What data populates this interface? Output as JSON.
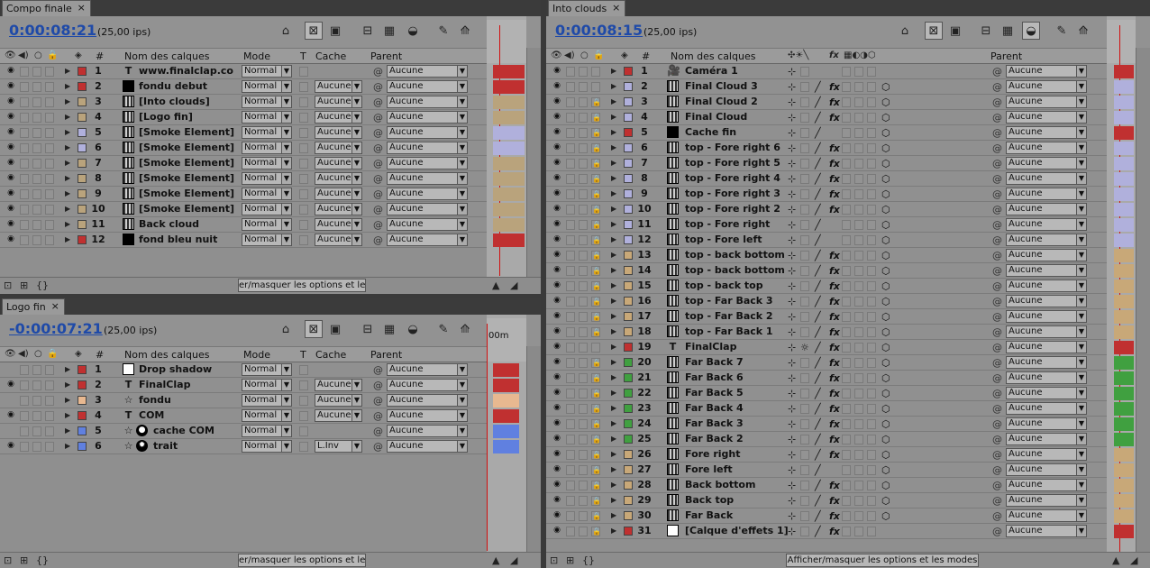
{
  "panels": {
    "compo": {
      "tab": "Compo finale",
      "timecode": "0:00:08:21",
      "fps": "(25,00 ips)",
      "col_headers": [
        "#",
        "Nom des calques",
        "Mode",
        "T",
        "Cache",
        "Parent"
      ],
      "footer_btn": "er/masquer les options et les m",
      "rows": [
        {
          "num": "1",
          "name": "www.finalclap.co",
          "type": "T",
          "label_color": "#c03030",
          "mode": "Normal",
          "cache": "",
          "parent": "Aucune",
          "eye": true
        },
        {
          "num": "2",
          "name": "fondu debut",
          "type": "solid-black",
          "label_color": "#c03030",
          "mode": "Normal",
          "cache": "Aucune",
          "parent": "Aucune",
          "eye": true
        },
        {
          "num": "3",
          "name": "[Into clouds]",
          "type": "comp",
          "label_color": "#b9a37c",
          "mode": "Normal",
          "cache": "Aucune",
          "parent": "Aucune",
          "eye": true
        },
        {
          "num": "4",
          "name": "[Logo fin]",
          "type": "comp",
          "label_color": "#b9a37c",
          "mode": "Normal",
          "cache": "Aucune",
          "parent": "Aucune",
          "eye": true
        },
        {
          "num": "5",
          "name": "[Smoke Element]",
          "type": "comp",
          "label_color": "#b0b0dc",
          "mode": "Normal",
          "cache": "Aucune",
          "parent": "Aucune",
          "eye": true
        },
        {
          "num": "6",
          "name": "[Smoke Element]",
          "type": "comp",
          "label_color": "#b0b0dc",
          "mode": "Normal",
          "cache": "Aucune",
          "parent": "Aucune",
          "eye": true
        },
        {
          "num": "7",
          "name": "[Smoke Element]",
          "type": "comp",
          "label_color": "#b9a37c",
          "mode": "Normal",
          "cache": "Aucune",
          "parent": "Aucune",
          "eye": true
        },
        {
          "num": "8",
          "name": "[Smoke Element]",
          "type": "comp",
          "label_color": "#b9a37c",
          "mode": "Normal",
          "cache": "Aucune",
          "parent": "Aucune",
          "eye": true
        },
        {
          "num": "9",
          "name": "[Smoke Element]",
          "type": "comp",
          "label_color": "#b9a37c",
          "mode": "Normal",
          "cache": "Aucune",
          "parent": "Aucune",
          "eye": true
        },
        {
          "num": "10",
          "name": "[Smoke Element]",
          "type": "comp",
          "label_color": "#b9a37c",
          "mode": "Normal",
          "cache": "Aucune",
          "parent": "Aucune",
          "eye": true
        },
        {
          "num": "11",
          "name": "Back cloud",
          "type": "comp",
          "label_color": "#b9a37c",
          "mode": "Normal",
          "cache": "Aucune",
          "parent": "Aucune",
          "eye": true
        },
        {
          "num": "12",
          "name": "fond bleu nuit",
          "type": "solid-black",
          "label_color": "#c03030",
          "mode": "Normal",
          "cache": "Aucune",
          "parent": "Aucune",
          "eye": true
        }
      ]
    },
    "logo": {
      "tab": "Logo fin",
      "timecode": "-0:00:07:21",
      "fps": "(25,00 ips)",
      "col_headers": [
        "#",
        "Nom des calques",
        "Mode",
        "T",
        "Cache",
        "Parent"
      ],
      "footer_btn": "er/masquer les options et les m",
      "ruler_label": "00m",
      "rows": [
        {
          "num": "1",
          "name": "Drop shadow",
          "type": "solid-white",
          "label_color": "#c03030",
          "mode": "Normal",
          "cache": "",
          "parent": "Aucune",
          "eye": false
        },
        {
          "num": "2",
          "name": "FinalClap",
          "type": "T",
          "label_color": "#c03030",
          "mode": "Normal",
          "cache": "Aucune",
          "parent": "Aucune",
          "eye": true
        },
        {
          "num": "3",
          "name": "fondu",
          "type": "star",
          "label_color": "#e8b890",
          "mode": "Normal",
          "cache": "Aucune",
          "parent": "Aucune",
          "eye": false
        },
        {
          "num": "4",
          "name": "COM",
          "type": "T",
          "label_color": "#c03030",
          "mode": "Normal",
          "cache": "Aucune",
          "parent": "Aucune",
          "eye": true
        },
        {
          "num": "5",
          "name": "cache COM",
          "type": "star-mask",
          "label_color": "#6080e0",
          "mode": "Normal",
          "cache": "",
          "parent": "Aucune",
          "eye": false
        },
        {
          "num": "6",
          "name": "trait",
          "type": "star-gear",
          "label_color": "#6080e0",
          "mode": "Normal",
          "cache": "L.Inv",
          "parent": "Aucune",
          "eye": true
        }
      ]
    },
    "clouds": {
      "tab": "Into clouds",
      "timecode": "0:00:08:15",
      "fps": "(25,00 ips)",
      "col_headers": [
        "#",
        "Nom des calques",
        "Parent"
      ],
      "footer_btn": "Afficher/masquer les options et les modes",
      "rows": [
        {
          "num": "1",
          "name": "Caméra 1",
          "type": "cam",
          "label_color": "#c03030",
          "lock": false,
          "slash": false,
          "fx": false,
          "cube": false
        },
        {
          "num": "2",
          "name": "Final Cloud 3",
          "type": "comp",
          "label_color": "#b0b0dc",
          "lock": false,
          "slash": true,
          "fx": true,
          "cube": true
        },
        {
          "num": "3",
          "name": "Final Cloud 2",
          "type": "comp",
          "label_color": "#b0b0dc",
          "lock": true,
          "slash": true,
          "fx": true,
          "cube": true
        },
        {
          "num": "4",
          "name": "Final Cloud",
          "type": "comp",
          "label_color": "#b0b0dc",
          "lock": true,
          "slash": true,
          "fx": true,
          "cube": true
        },
        {
          "num": "5",
          "name": "Cache fin",
          "type": "solid-black",
          "label_color": "#c03030",
          "lock": true,
          "slash": true,
          "fx": false,
          "cube": true
        },
        {
          "num": "6",
          "name": "top - Fore right 6",
          "type": "comp",
          "label_color": "#b0b0dc",
          "lock": true,
          "slash": true,
          "fx": true,
          "cube": true
        },
        {
          "num": "7",
          "name": "top - Fore right 5",
          "type": "comp",
          "label_color": "#b0b0dc",
          "lock": true,
          "slash": true,
          "fx": true,
          "cube": true
        },
        {
          "num": "8",
          "name": "top - Fore right 4",
          "type": "comp",
          "label_color": "#b0b0dc",
          "lock": true,
          "slash": true,
          "fx": true,
          "cube": true
        },
        {
          "num": "9",
          "name": "top - Fore right 3",
          "type": "comp",
          "label_color": "#b0b0dc",
          "lock": true,
          "slash": true,
          "fx": true,
          "cube": true
        },
        {
          "num": "10",
          "name": "top - Fore right 2",
          "type": "comp",
          "label_color": "#b0b0dc",
          "lock": true,
          "slash": true,
          "fx": true,
          "cube": true
        },
        {
          "num": "11",
          "name": "top - Fore right",
          "type": "comp",
          "label_color": "#b0b0dc",
          "lock": true,
          "slash": true,
          "fx": false,
          "cube": true
        },
        {
          "num": "12",
          "name": "top - Fore left",
          "type": "comp",
          "label_color": "#b0b0dc",
          "lock": true,
          "slash": true,
          "fx": false,
          "cube": true
        },
        {
          "num": "13",
          "name": "top - back bottom",
          "type": "comp",
          "label_color": "#c8a878",
          "lock": true,
          "slash": true,
          "fx": true,
          "cube": true
        },
        {
          "num": "14",
          "name": "top - back bottom",
          "type": "comp",
          "label_color": "#c8a878",
          "lock": true,
          "slash": true,
          "fx": true,
          "cube": true
        },
        {
          "num": "15",
          "name": "top - back top",
          "type": "comp",
          "label_color": "#c8a878",
          "lock": true,
          "slash": true,
          "fx": true,
          "cube": true
        },
        {
          "num": "16",
          "name": "top - Far Back 3",
          "type": "comp",
          "label_color": "#c8a878",
          "lock": true,
          "slash": true,
          "fx": true,
          "cube": true
        },
        {
          "num": "17",
          "name": "top - Far Back 2",
          "type": "comp",
          "label_color": "#c8a878",
          "lock": true,
          "slash": true,
          "fx": true,
          "cube": true
        },
        {
          "num": "18",
          "name": "top - Far Back 1",
          "type": "comp",
          "label_color": "#c8a878",
          "lock": true,
          "slash": true,
          "fx": true,
          "cube": true
        },
        {
          "num": "19",
          "name": "FinalClap",
          "type": "T",
          "label_color": "#c03030",
          "lock": false,
          "slash": true,
          "fx": true,
          "cube": true
        },
        {
          "num": "20",
          "name": "Far Back 7",
          "type": "comp",
          "label_color": "#40a040",
          "lock": true,
          "slash": true,
          "fx": true,
          "cube": true
        },
        {
          "num": "21",
          "name": "Far Back 6",
          "type": "comp",
          "label_color": "#40a040",
          "lock": true,
          "slash": true,
          "fx": true,
          "cube": true
        },
        {
          "num": "22",
          "name": "Far Back 5",
          "type": "comp",
          "label_color": "#40a040",
          "lock": true,
          "slash": true,
          "fx": true,
          "cube": true
        },
        {
          "num": "23",
          "name": "Far Back 4",
          "type": "comp",
          "label_color": "#40a040",
          "lock": true,
          "slash": true,
          "fx": true,
          "cube": true
        },
        {
          "num": "24",
          "name": "Far Back 3",
          "type": "comp",
          "label_color": "#40a040",
          "lock": true,
          "slash": true,
          "fx": true,
          "cube": true
        },
        {
          "num": "25",
          "name": "Far Back 2",
          "type": "comp",
          "label_color": "#40a040",
          "lock": true,
          "slash": true,
          "fx": true,
          "cube": true
        },
        {
          "num": "26",
          "name": "Fore right",
          "type": "comp",
          "label_color": "#c8a878",
          "lock": true,
          "slash": true,
          "fx": true,
          "cube": true
        },
        {
          "num": "27",
          "name": "Fore left",
          "type": "comp",
          "label_color": "#c8a878",
          "lock": true,
          "slash": true,
          "fx": false,
          "cube": true
        },
        {
          "num": "28",
          "name": "Back bottom",
          "type": "comp",
          "label_color": "#c8a878",
          "lock": true,
          "slash": true,
          "fx": true,
          "cube": true
        },
        {
          "num": "29",
          "name": "Back top",
          "type": "comp",
          "label_color": "#c8a878",
          "lock": true,
          "slash": true,
          "fx": true,
          "cube": true
        },
        {
          "num": "30",
          "name": "Far Back",
          "type": "comp",
          "label_color": "#c8a878",
          "lock": true,
          "slash": true,
          "fx": true,
          "cube": true
        },
        {
          "num": "31",
          "name": "[Calque d'effets 1]",
          "type": "solid-white",
          "label_color": "#c03030",
          "lock": true,
          "slash": true,
          "fx": true,
          "cube": false
        }
      ]
    }
  },
  "common": {
    "parent_value": "Aucune",
    "fx_label": "fx"
  }
}
